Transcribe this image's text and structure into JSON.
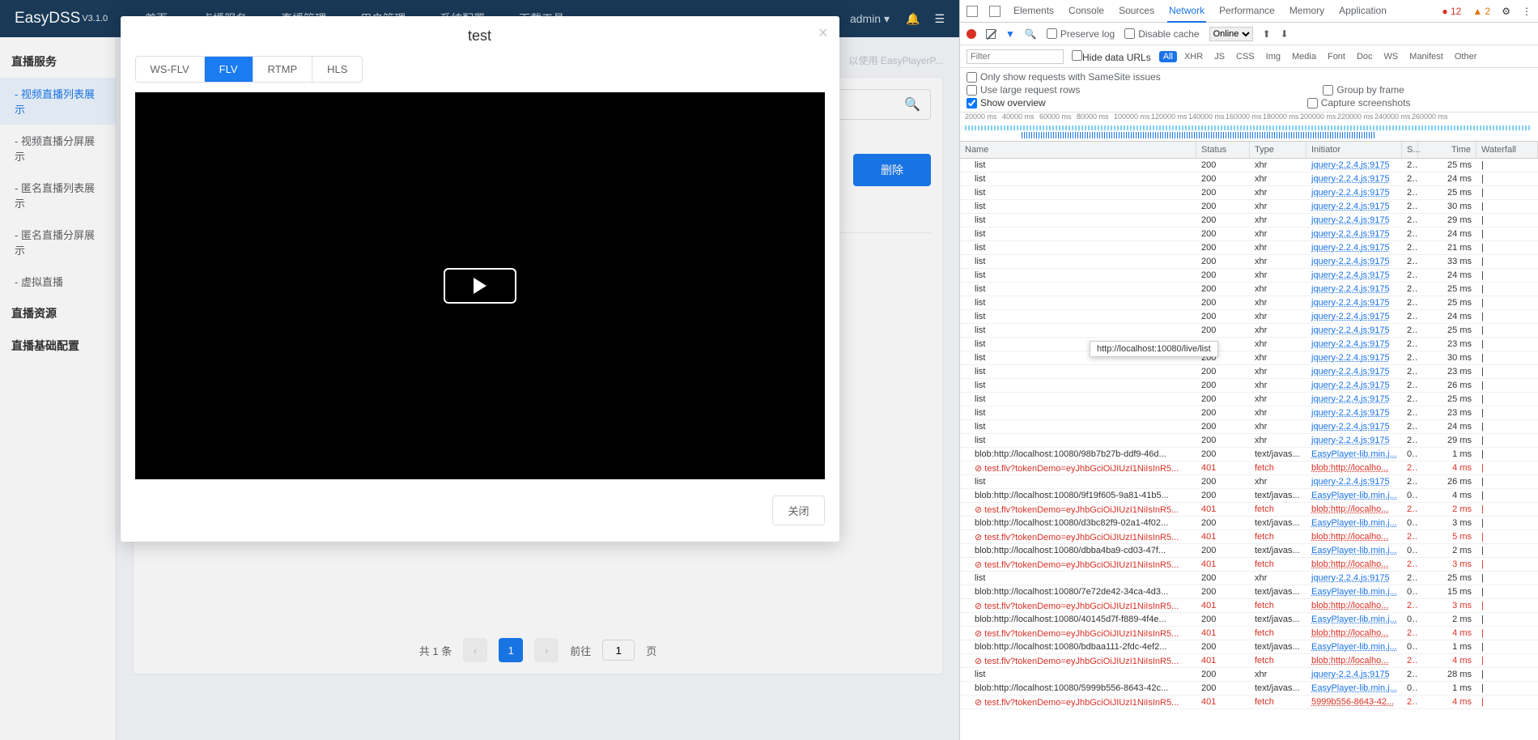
{
  "header": {
    "brand": "EasyDSS",
    "version": "V3.1.0",
    "nav": [
      "首页",
      "点播服务",
      "直播管理",
      "用户管理",
      "系统配置",
      "下载工具"
    ],
    "user": "admin ▾"
  },
  "sidebar": {
    "sections": {
      "s1": {
        "title": "直播服务",
        "items": [
          "视频直播列表展示",
          "视频直播分屏展示",
          "匿名直播列表展示",
          "匿名直播分屏展示",
          "虚拟直播"
        ]
      },
      "s2": {
        "title": "直播资源"
      },
      "s3": {
        "title": "直播基础配置"
      }
    },
    "activeItem": "视频直播列表展示"
  },
  "content": {
    "tip_right": "以使用 EasyPlayerP...",
    "delete_btn": "删除",
    "total_label": "共 1 条",
    "page_go": "前往",
    "page_unit": "页",
    "page_current": "1",
    "go_value": "1"
  },
  "modal": {
    "title": "test",
    "tabs": [
      "WS-FLV",
      "FLV",
      "RTMP",
      "HLS"
    ],
    "activeTab": "FLV",
    "close_btn": "关闭"
  },
  "devtools": {
    "tabs": [
      "Elements",
      "Console",
      "Sources",
      "Network",
      "Performance",
      "Memory",
      "Application"
    ],
    "activeTab": "Network",
    "errors": "● 12",
    "warnings": "▲ 2",
    "toolbar": {
      "preserve": "Preserve log",
      "disable": "Disable cache",
      "throttle": "Online"
    },
    "filter": {
      "placeholder": "Filter",
      "hide": "Hide data URLs",
      "pills": [
        "All",
        "XHR",
        "JS",
        "CSS",
        "Img",
        "Media",
        "Font",
        "Doc",
        "WS",
        "Manifest",
        "Other"
      ],
      "activePill": "All"
    },
    "opts": {
      "samesite": "Only show requests with SameSite issues",
      "large": "Use large request rows",
      "overview": "Show overview",
      "group": "Group by frame",
      "capture": "Capture screenshots"
    },
    "ticks": [
      "20000 ms",
      "40000 ms",
      "60000 ms",
      "80000 ms",
      "100000 ms",
      "120000 ms",
      "140000 ms",
      "160000 ms",
      "180000 ms",
      "200000 ms",
      "220000 ms",
      "240000 ms",
      "260000 ms"
    ],
    "columns": {
      "name": "Name",
      "status": "Status",
      "type": "Type",
      "initiator": "Initiator",
      "size": "S...",
      "time": "Time",
      "wf": "Waterfall"
    },
    "tooltip": "http://localhost:10080/live/list",
    "rows": [
      {
        "name": "list",
        "status": "200",
        "type": "xhr",
        "initiator": "jquery-2.2.4.js:9175",
        "size": "2...",
        "time": "25 ms"
      },
      {
        "name": "list",
        "status": "200",
        "type": "xhr",
        "initiator": "jquery-2.2.4.js:9175",
        "size": "2...",
        "time": "24 ms"
      },
      {
        "name": "list",
        "status": "200",
        "type": "xhr",
        "initiator": "jquery-2.2.4.js:9175",
        "size": "2...",
        "time": "25 ms"
      },
      {
        "name": "list",
        "status": "200",
        "type": "xhr",
        "initiator": "jquery-2.2.4.js:9175",
        "size": "2...",
        "time": "30 ms"
      },
      {
        "name": "list",
        "status": "200",
        "type": "xhr",
        "initiator": "jquery-2.2.4.js:9175",
        "size": "2...",
        "time": "29 ms"
      },
      {
        "name": "list",
        "status": "200",
        "type": "xhr",
        "initiator": "jquery-2.2.4.js:9175",
        "size": "2...",
        "time": "24 ms"
      },
      {
        "name": "list",
        "status": "200",
        "type": "xhr",
        "initiator": "jquery-2.2.4.js:9175",
        "size": "2...",
        "time": "21 ms"
      },
      {
        "name": "list",
        "status": "200",
        "type": "xhr",
        "initiator": "jquery-2.2.4.js:9175",
        "size": "2...",
        "time": "33 ms"
      },
      {
        "name": "list",
        "status": "200",
        "type": "xhr",
        "initiator": "jquery-2.2.4.js:9175",
        "size": "2...",
        "time": "24 ms"
      },
      {
        "name": "list",
        "status": "200",
        "type": "xhr",
        "initiator": "jquery-2.2.4.js:9175",
        "size": "2...",
        "time": "25 ms"
      },
      {
        "name": "list",
        "status": "200",
        "type": "xhr",
        "initiator": "jquery-2.2.4.js:9175",
        "size": "2...",
        "time": "25 ms"
      },
      {
        "name": "list",
        "status": "200",
        "type": "xhr",
        "initiator": "jquery-2.2.4.js:9175",
        "size": "2...",
        "time": "24 ms"
      },
      {
        "name": "list",
        "status": "200",
        "type": "xhr",
        "initiator": "jquery-2.2.4.js:9175",
        "size": "2...",
        "time": "25 ms"
      },
      {
        "name": "list",
        "status": "",
        "type": "xhr",
        "initiator": "jquery-2.2.4.js:9175",
        "size": "2...",
        "time": "23 ms"
      },
      {
        "name": "list",
        "status": "200",
        "type": "xhr",
        "initiator": "jquery-2.2.4.js:9175",
        "size": "2...",
        "time": "30 ms"
      },
      {
        "name": "list",
        "status": "200",
        "type": "xhr",
        "initiator": "jquery-2.2.4.js:9175",
        "size": "2...",
        "time": "23 ms"
      },
      {
        "name": "list",
        "status": "200",
        "type": "xhr",
        "initiator": "jquery-2.2.4.js:9175",
        "size": "2...",
        "time": "26 ms"
      },
      {
        "name": "list",
        "status": "200",
        "type": "xhr",
        "initiator": "jquery-2.2.4.js:9175",
        "size": "2...",
        "time": "25 ms"
      },
      {
        "name": "list",
        "status": "200",
        "type": "xhr",
        "initiator": "jquery-2.2.4.js:9175",
        "size": "2...",
        "time": "23 ms"
      },
      {
        "name": "list",
        "status": "200",
        "type": "xhr",
        "initiator": "jquery-2.2.4.js:9175",
        "size": "2...",
        "time": "24 ms"
      },
      {
        "name": "list",
        "status": "200",
        "type": "xhr",
        "initiator": "jquery-2.2.4.js:9175",
        "size": "2...",
        "time": "29 ms"
      },
      {
        "name": "blob:http://localhost:10080/98b7b27b-ddf9-46d...",
        "status": "200",
        "type": "text/javas...",
        "initiator": "EasyPlayer-lib.min.j...",
        "size": "0...",
        "time": "1 ms"
      },
      {
        "name": "test.flv?tokenDemo=eyJhbGciOiJIUzI1NiIsInR5...",
        "status": "401",
        "type": "fetch",
        "initiator": "blob:http://localho...",
        "size": "2...",
        "time": "4 ms",
        "red": true
      },
      {
        "name": "list",
        "status": "200",
        "type": "xhr",
        "initiator": "jquery-2.2.4.js:9175",
        "size": "2...",
        "time": "26 ms"
      },
      {
        "name": "blob:http://localhost:10080/9f19f605-9a81-41b5...",
        "status": "200",
        "type": "text/javas...",
        "initiator": "EasyPlayer-lib.min.j...",
        "size": "0...",
        "time": "4 ms"
      },
      {
        "name": "test.flv?tokenDemo=eyJhbGciOiJIUzI1NiIsInR5...",
        "status": "401",
        "type": "fetch",
        "initiator": "blob:http://localho...",
        "size": "2...",
        "time": "2 ms",
        "red": true
      },
      {
        "name": "blob:http://localhost:10080/d3bc82f9-02a1-4f02...",
        "status": "200",
        "type": "text/javas...",
        "initiator": "EasyPlayer-lib.min.j...",
        "size": "0...",
        "time": "3 ms"
      },
      {
        "name": "test.flv?tokenDemo=eyJhbGciOiJIUzI1NiIsInR5...",
        "status": "401",
        "type": "fetch",
        "initiator": "blob:http://localho...",
        "size": "2...",
        "time": "5 ms",
        "red": true
      },
      {
        "name": "blob:http://localhost:10080/dbba4ba9-cd03-47f...",
        "status": "200",
        "type": "text/javas...",
        "initiator": "EasyPlayer-lib.min.j...",
        "size": "0...",
        "time": "2 ms"
      },
      {
        "name": "test.flv?tokenDemo=eyJhbGciOiJIUzI1NiIsInR5...",
        "status": "401",
        "type": "fetch",
        "initiator": "blob:http://localho...",
        "size": "2...",
        "time": "3 ms",
        "red": true
      },
      {
        "name": "list",
        "status": "200",
        "type": "xhr",
        "initiator": "jquery-2.2.4.js:9175",
        "size": "2...",
        "time": "25 ms"
      },
      {
        "name": "blob:http://localhost:10080/7e72de42-34ca-4d3...",
        "status": "200",
        "type": "text/javas...",
        "initiator": "EasyPlayer-lib.min.j...",
        "size": "0...",
        "time": "15 ms"
      },
      {
        "name": "test.flv?tokenDemo=eyJhbGciOiJIUzI1NiIsInR5...",
        "status": "401",
        "type": "fetch",
        "initiator": "blob:http://localho...",
        "size": "2...",
        "time": "3 ms",
        "red": true
      },
      {
        "name": "blob:http://localhost:10080/40145d7f-f889-4f4e...",
        "status": "200",
        "type": "text/javas...",
        "initiator": "EasyPlayer-lib.min.j...",
        "size": "0...",
        "time": "2 ms"
      },
      {
        "name": "test.flv?tokenDemo=eyJhbGciOiJIUzI1NiIsInR5...",
        "status": "401",
        "type": "fetch",
        "initiator": "blob:http://localho...",
        "size": "2...",
        "time": "4 ms",
        "red": true
      },
      {
        "name": "blob:http://localhost:10080/bdbaa111-2fdc-4ef2...",
        "status": "200",
        "type": "text/javas...",
        "initiator": "EasyPlayer-lib.min.j...",
        "size": "0...",
        "time": "1 ms"
      },
      {
        "name": "test.flv?tokenDemo=eyJhbGciOiJIUzI1NiIsInR5...",
        "status": "401",
        "type": "fetch",
        "initiator": "blob:http://localho...",
        "size": "2...",
        "time": "4 ms",
        "red": true
      },
      {
        "name": "list",
        "status": "200",
        "type": "xhr",
        "initiator": "jquery-2.2.4.js:9175",
        "size": "2...",
        "time": "28 ms"
      },
      {
        "name": "blob:http://localhost:10080/5999b556-8643-42c...",
        "status": "200",
        "type": "text/javas...",
        "initiator": "EasyPlayer-lib.min.j...",
        "size": "0...",
        "time": "1 ms"
      },
      {
        "name": "test.flv?tokenDemo=eyJhbGciOiJIUzI1NiIsInR5...",
        "status": "401",
        "type": "fetch",
        "initiator": "5999b556-8643-42...",
        "size": "2...",
        "time": "4 ms",
        "red": true
      }
    ]
  }
}
